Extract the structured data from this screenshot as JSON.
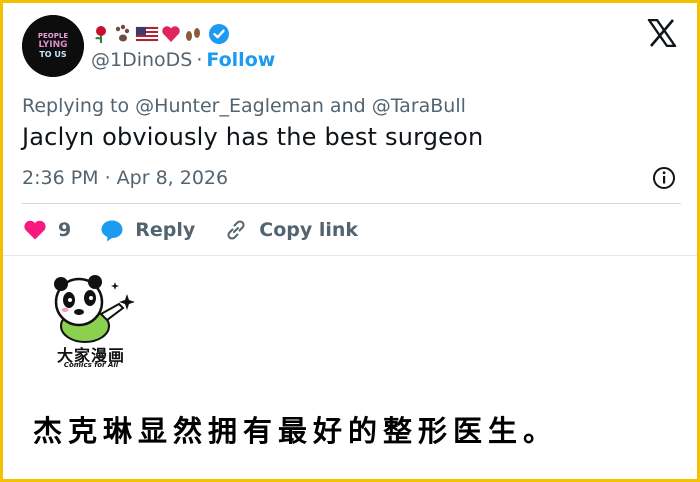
{
  "tweet": {
    "display_name_emojis": [
      "rose-icon",
      "paw-prints-icon",
      "us-flag-icon",
      "red-heart-icon",
      "footprints-icon"
    ],
    "handle": "@1DinoDS",
    "separator": "·",
    "follow_label": "Follow",
    "reply_prefix": "Replying to",
    "reply_user_1": "@Hunter_Eagleman",
    "reply_and": "and",
    "reply_user_2": "@TaraBull",
    "text": "Jaclyn obviously has the best surgeon",
    "timestamp": "2:36 PM · Apr 8, 2026",
    "likes": "9",
    "reply_label": "Reply",
    "copy_link_label": "Copy link",
    "avatar_text_1": "PEOPLE",
    "avatar_text_2": "LYING",
    "avatar_text_3": "TO US"
  },
  "panel": {
    "logo_title": "大家漫画",
    "logo_subtitle": "Comics for All",
    "translation": "杰克琳显然拥有最好的整形医生。"
  },
  "colors": {
    "accent": "#1d9bf0",
    "like": "#f91880",
    "secondary_text": "#536471",
    "frame": "#f2c200"
  }
}
